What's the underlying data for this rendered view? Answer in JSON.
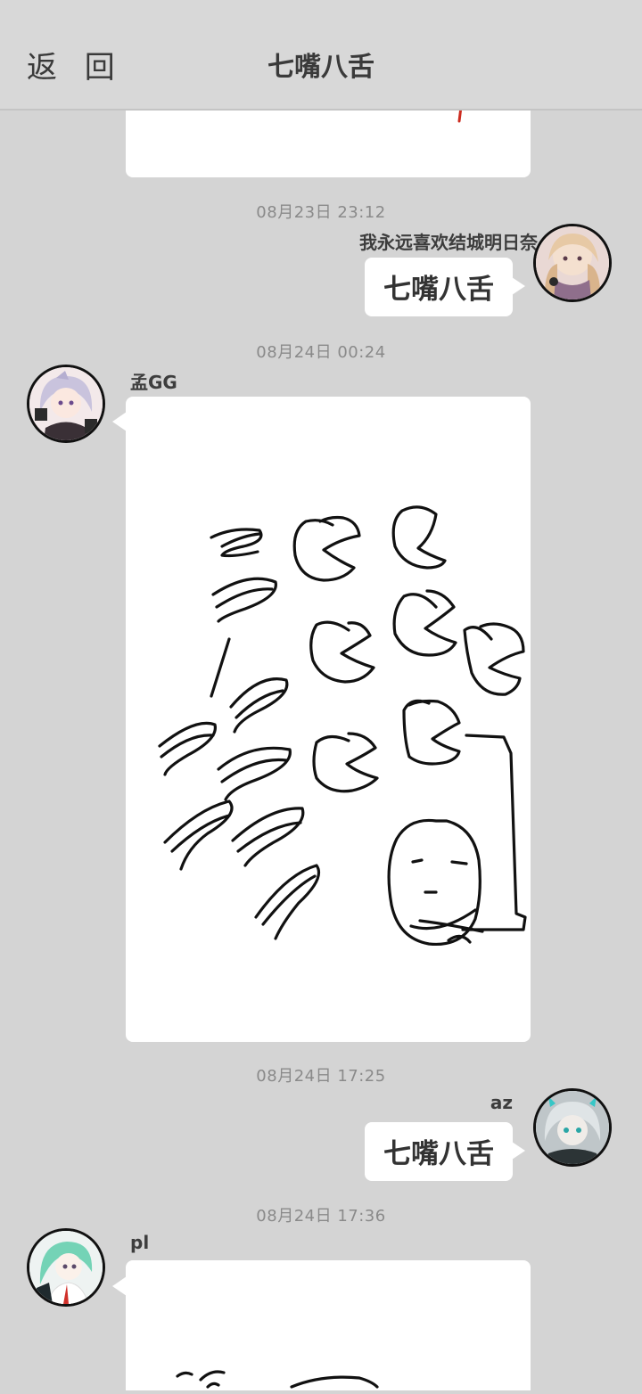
{
  "header": {
    "back_label": "返 回",
    "title": "七嘴八舌"
  },
  "messages": [
    {
      "time": "08月23日  23:12",
      "sender": "我永远喜欢结城明日奈",
      "side": "right",
      "type": "text",
      "text": "七嘴八舌"
    },
    {
      "time": "08月24日  00:24",
      "sender": "孟GG",
      "side": "left",
      "type": "doodle"
    },
    {
      "time": "08月24日  17:25",
      "sender": "az",
      "side": "right",
      "type": "text",
      "text": "七嘴八舌"
    },
    {
      "time": "08月24日  17:36",
      "sender": "pl",
      "side": "left",
      "type": "doodle"
    }
  ],
  "colors": {
    "background": "#d4d4d4",
    "bubble": "#ffffff",
    "ink": "#111111",
    "time_text": "#8a8a8a",
    "red_mark": "#cc2b1f"
  }
}
